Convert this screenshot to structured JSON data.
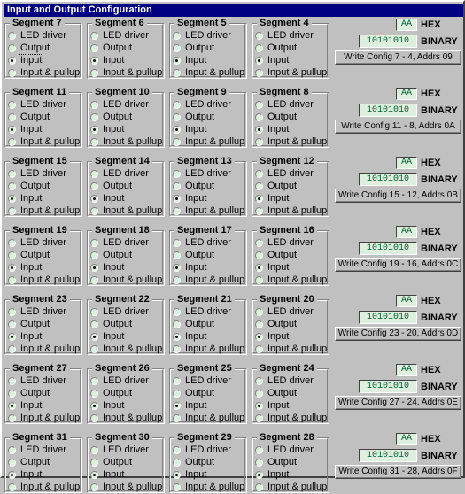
{
  "window": {
    "title": "Input and Output Configuration",
    "colors": {
      "titlebar": "#000080",
      "titlebar_text": "#ffffff",
      "face": "#c0c0c0",
      "field_background": "#dfefdf",
      "field_text": "#006030"
    }
  },
  "options": [
    "LED driver",
    "Output",
    "Input",
    "Input & pullup"
  ],
  "segments": [
    {
      "title": "Segment 7",
      "selected": 2,
      "focused": true
    },
    {
      "title": "Segment 6",
      "selected": 2,
      "focused": false
    },
    {
      "title": "Segment 5",
      "selected": 2,
      "focused": false
    },
    {
      "title": "Segment 4",
      "selected": 2,
      "focused": false
    },
    {
      "title": "Segment 11",
      "selected": 2,
      "focused": false
    },
    {
      "title": "Segment 10",
      "selected": 2,
      "focused": false
    },
    {
      "title": "Segment 9",
      "selected": 2,
      "focused": false
    },
    {
      "title": "Segment 8",
      "selected": 2,
      "focused": false
    },
    {
      "title": "Segment 15",
      "selected": 2,
      "focused": false
    },
    {
      "title": "Segment 14",
      "selected": 2,
      "focused": false
    },
    {
      "title": "Segment 13",
      "selected": 2,
      "focused": false
    },
    {
      "title": "Segment 12",
      "selected": 2,
      "focused": false
    },
    {
      "title": "Segment 19",
      "selected": 2,
      "focused": false
    },
    {
      "title": "Segment 18",
      "selected": 2,
      "focused": false
    },
    {
      "title": "Segment 17",
      "selected": 2,
      "focused": false
    },
    {
      "title": "Segment 16",
      "selected": 2,
      "focused": false
    },
    {
      "title": "Segment 23",
      "selected": 2,
      "focused": false
    },
    {
      "title": "Segment 22",
      "selected": 2,
      "focused": false
    },
    {
      "title": "Segment 21",
      "selected": 2,
      "focused": false
    },
    {
      "title": "Segment 20",
      "selected": 2,
      "focused": false
    },
    {
      "title": "Segment 27",
      "selected": 2,
      "focused": false
    },
    {
      "title": "Segment 26",
      "selected": 2,
      "focused": false
    },
    {
      "title": "Segment 25",
      "selected": 2,
      "focused": false
    },
    {
      "title": "Segment 24",
      "selected": 2,
      "focused": false
    },
    {
      "title": "Segment 31",
      "selected": 2,
      "focused": false
    },
    {
      "title": "Segment 30",
      "selected": 2,
      "focused": false
    },
    {
      "title": "Segment 29",
      "selected": 2,
      "focused": false
    },
    {
      "title": "Segment 28",
      "selected": 2,
      "focused": false
    }
  ],
  "labels": {
    "hex": "HEX",
    "binary": "BINARY"
  },
  "configs": [
    {
      "hex": "AA",
      "binary": "10101010",
      "button": "Write Config 7 - 4, Addrs 09"
    },
    {
      "hex": "AA",
      "binary": "10101010",
      "button": "Write Config 11 - 8, Addrs 0A"
    },
    {
      "hex": "AA",
      "binary": "10101010",
      "button": "Write Config 15 - 12, Addrs 0B"
    },
    {
      "hex": "AA",
      "binary": "10101010",
      "button": "Write Config 19 - 16, Addrs 0C"
    },
    {
      "hex": "AA",
      "binary": "10101010",
      "button": "Write Config 23 - 20, Addrs 0D"
    },
    {
      "hex": "AA",
      "binary": "10101010",
      "button": "Write Config 27 - 24, Addrs 0E"
    },
    {
      "hex": "AA",
      "binary": "10101010",
      "button": "Write Config 31 - 28, Addrs 0F"
    }
  ]
}
